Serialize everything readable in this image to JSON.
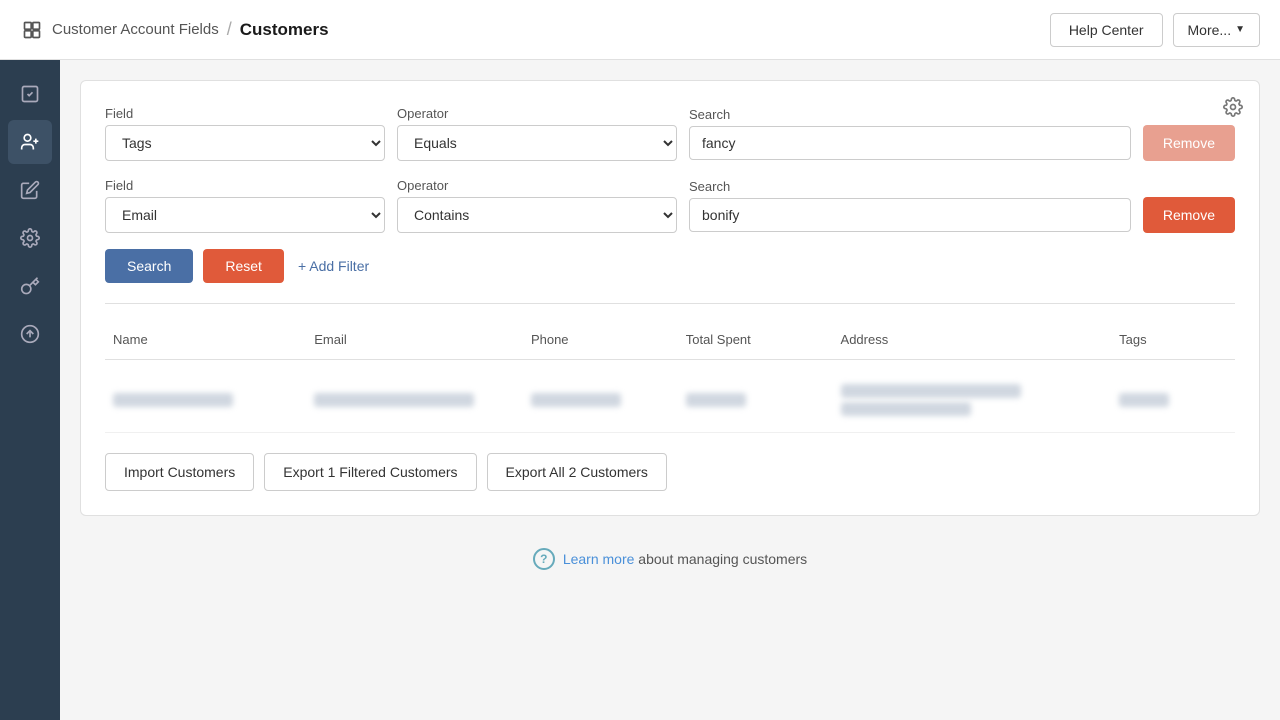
{
  "nav": {
    "app_name": "Customer Account Fields",
    "separator": "/",
    "current_page": "Customers",
    "help_label": "Help Center",
    "more_label": "More..."
  },
  "sidebar": {
    "items": [
      {
        "id": "checklist",
        "label": "Checklist"
      },
      {
        "id": "customers",
        "label": "Customers",
        "active": true
      },
      {
        "id": "edit",
        "label": "Edit"
      },
      {
        "id": "settings",
        "label": "Settings"
      },
      {
        "id": "key",
        "label": "Key"
      },
      {
        "id": "upload",
        "label": "Upload"
      }
    ]
  },
  "filter": {
    "row1": {
      "field_label": "Field",
      "field_value": "Tags",
      "operator_label": "Operator",
      "operator_value": "Equals",
      "search_label": "Search",
      "search_value": "fancy",
      "remove_label": "Remove"
    },
    "row2": {
      "field_label": "Field",
      "field_value": "Email",
      "operator_label": "Operator",
      "operator_value": "Contains",
      "search_label": "Search",
      "search_value": "bonify",
      "remove_label": "Remove"
    },
    "search_button": "Search",
    "reset_button": "Reset",
    "add_filter_label": "+ Add Filter"
  },
  "table": {
    "headers": [
      "Name",
      "Email",
      "Phone",
      "Total Spent",
      "Address",
      "Tags"
    ],
    "rows": [
      {
        "name_blur": true,
        "email_blur": true,
        "phone_blur": true,
        "spent_blur": true,
        "address_blur": true,
        "tags_blur": true
      }
    ]
  },
  "actions": {
    "import_label": "Import Customers",
    "export_filtered_label": "Export 1 Filtered Customers",
    "export_all_label": "Export All 2 Customers"
  },
  "footer": {
    "learn_more_link": "Learn more",
    "description": "about managing customers"
  }
}
